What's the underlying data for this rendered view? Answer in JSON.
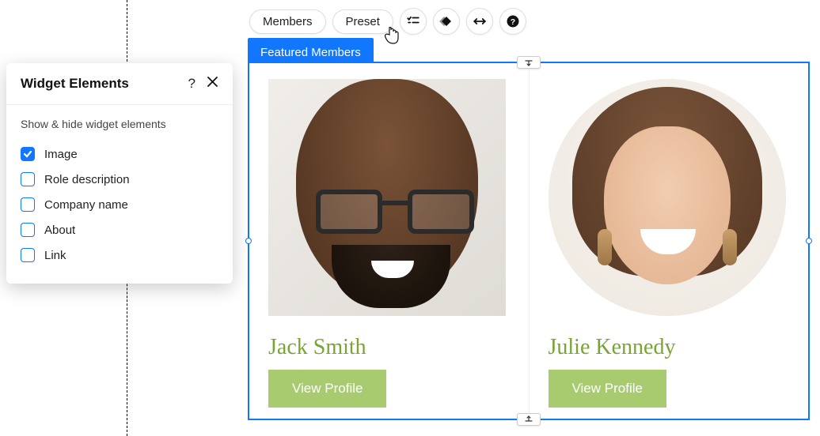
{
  "toolbar": {
    "members_label": "Members",
    "preset_label": "Preset",
    "icons": [
      "checklist-icon",
      "animation-icon",
      "stretch-icon",
      "help-icon"
    ]
  },
  "widget_tab": {
    "label": "Featured Members"
  },
  "cards": [
    {
      "name": "Jack Smith",
      "button": "View Profile",
      "avatar": "man-glasses"
    },
    {
      "name": "Julie Kennedy",
      "button": "View Profile",
      "avatar": "woman-earrings"
    }
  ],
  "panel": {
    "title": "Widget Elements",
    "subtitle": "Show & hide widget elements",
    "items": [
      {
        "label": "Image",
        "checked": true
      },
      {
        "label": "Role description",
        "checked": false
      },
      {
        "label": "Company name",
        "checked": false
      },
      {
        "label": "About",
        "checked": false
      },
      {
        "label": "Link",
        "checked": false
      }
    ]
  }
}
